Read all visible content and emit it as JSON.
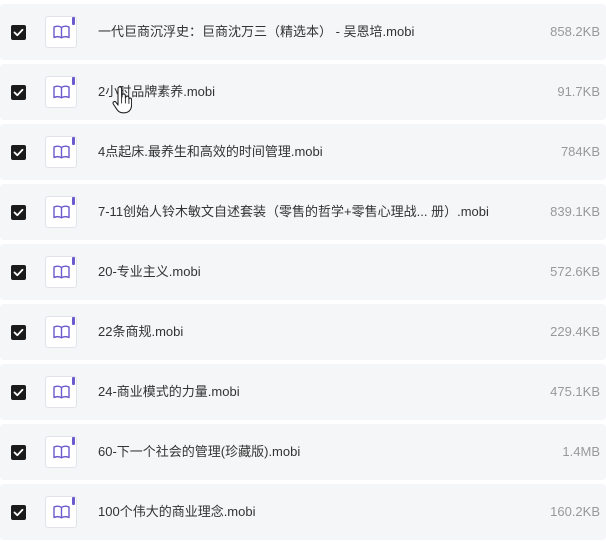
{
  "files": [
    {
      "name": "一代巨商沉浮史：巨商沈万三（精选本） - 吴恩培.mobi",
      "size": "858.2KB",
      "checked": true,
      "icon": "book-icon"
    },
    {
      "name": "2小时品牌素养.mobi",
      "size": "91.7KB",
      "checked": true,
      "icon": "book-icon"
    },
    {
      "name": "4点起床.最养生和高效的时间管理.mobi",
      "size": "784KB",
      "checked": true,
      "icon": "book-icon"
    },
    {
      "name": "7-11创始人铃木敏文自述套装（零售的哲学+零售心理战... 册）.mobi",
      "size": "839.1KB",
      "checked": true,
      "icon": "book-icon"
    },
    {
      "name": "20-专业主义.mobi",
      "size": "572.6KB",
      "checked": true,
      "icon": "book-icon"
    },
    {
      "name": "22条商规.mobi",
      "size": "229.4KB",
      "checked": true,
      "icon": "book-icon"
    },
    {
      "name": "24-商业模式的力量.mobi",
      "size": "475.1KB",
      "checked": true,
      "icon": "book-icon"
    },
    {
      "name": "60-下一个社会的管理(珍藏版).mobi",
      "size": "1.4MB",
      "checked": true,
      "icon": "book-icon"
    },
    {
      "name": "100个伟大的商业理念.mobi",
      "size": "160.2KB",
      "checked": true,
      "icon": "book-icon"
    }
  ],
  "colors": {
    "row_bg": "#f5f6f8",
    "checkbox": "#1b1b1b",
    "icon_accent": "#6a5acd",
    "name_text": "#333333",
    "size_text": "#999999"
  }
}
